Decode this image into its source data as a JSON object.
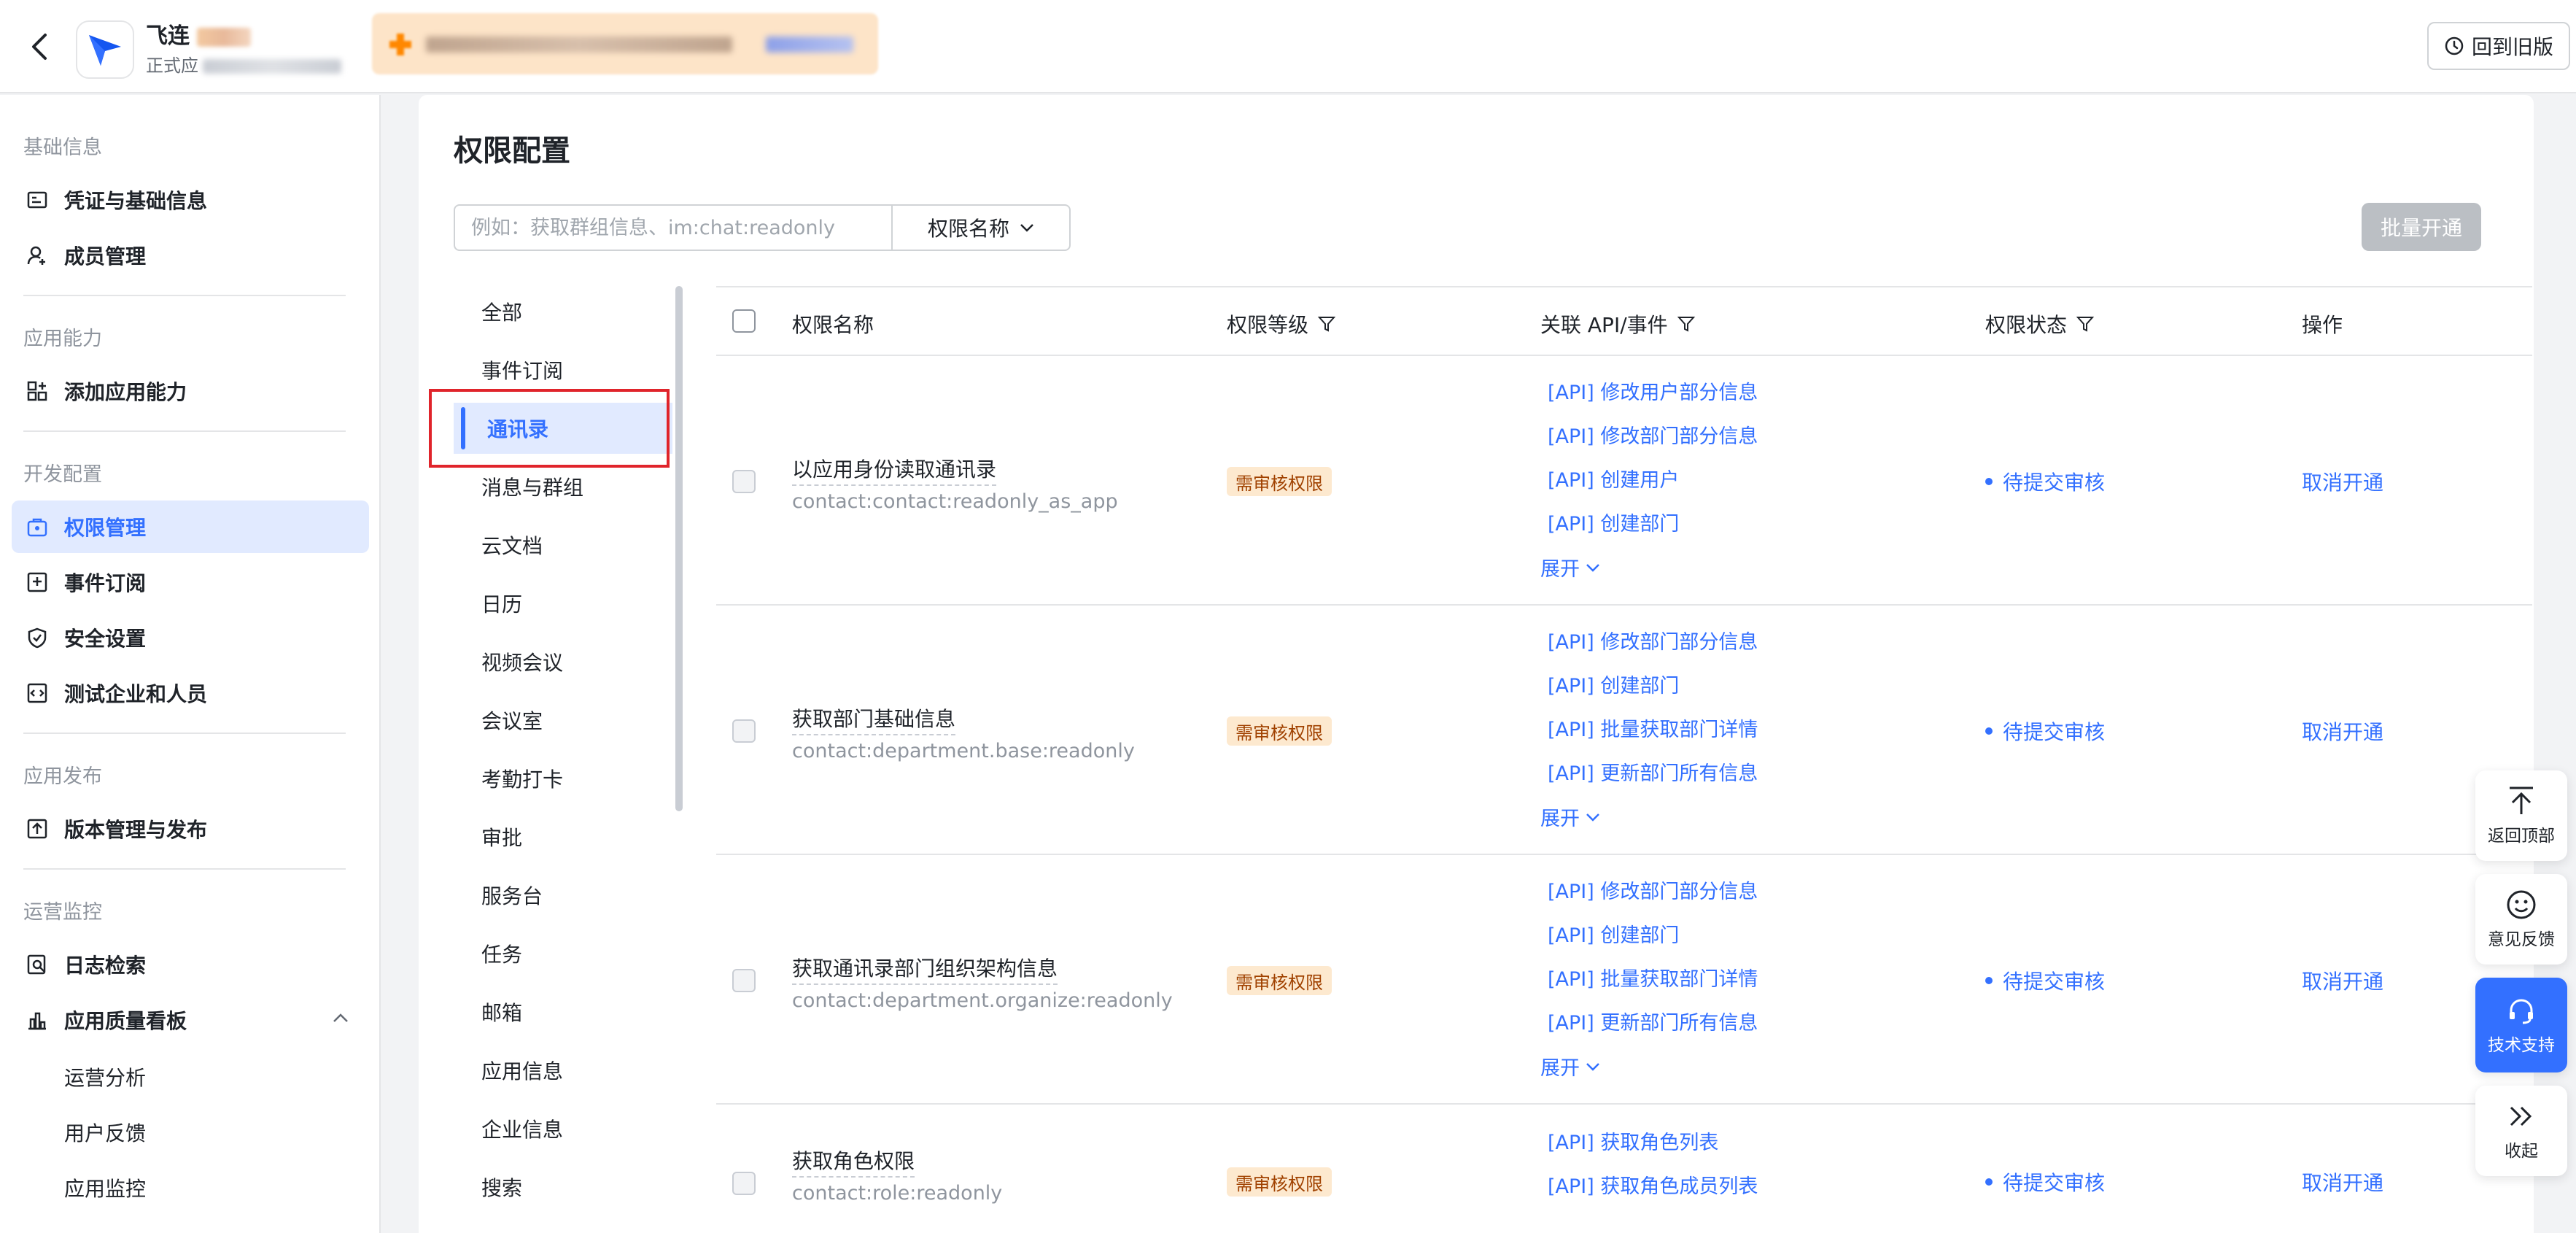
{
  "topbar": {
    "app_name": "飞连",
    "app_subtitle": "正式应",
    "old_version_label": "回到旧版"
  },
  "sidebar": {
    "groups": [
      {
        "title": "基础信息",
        "items": [
          {
            "label": "凭证与基础信息",
            "icon": "credential-icon"
          },
          {
            "label": "成员管理",
            "icon": "member-icon"
          }
        ]
      },
      {
        "title": "应用能力",
        "items": [
          {
            "label": "添加应用能力",
            "icon": "add-capability-icon"
          }
        ]
      },
      {
        "title": "开发配置",
        "items": [
          {
            "label": "权限管理",
            "icon": "permission-icon",
            "active": true
          },
          {
            "label": "事件订阅",
            "icon": "event-icon"
          },
          {
            "label": "安全设置",
            "icon": "shield-icon"
          },
          {
            "label": "测试企业和人员",
            "icon": "test-icon"
          }
        ]
      },
      {
        "title": "应用发布",
        "items": [
          {
            "label": "版本管理与发布",
            "icon": "upload-icon"
          }
        ]
      },
      {
        "title": "运营监控",
        "items": [
          {
            "label": "日志检索",
            "icon": "log-search-icon"
          },
          {
            "label": "应用质量看板",
            "icon": "chart-icon",
            "expanded": true
          }
        ]
      }
    ],
    "sub_items": [
      "运营分析",
      "用户反馈",
      "应用监控"
    ]
  },
  "main": {
    "title": "权限配置",
    "search_placeholder": "例如：获取群组信息、im:chat:readonly",
    "search_filter_label": "权限名称",
    "batch_button": "批量开通",
    "categories": [
      "全部",
      "事件订阅",
      "通讯录",
      "消息与群组",
      "云文档",
      "日历",
      "视频会议",
      "会议室",
      "考勤打卡",
      "审批",
      "服务台",
      "任务",
      "邮箱",
      "应用信息",
      "企业信息",
      "搜索"
    ],
    "active_category": "通讯录",
    "table": {
      "headers": [
        "权限名称",
        "权限等级",
        "关联 API/事件",
        "权限状态",
        "操作"
      ],
      "rows": [
        {
          "name": "以应用身份读取通讯录",
          "key": "contact:contact:readonly_as_app",
          "level": "需审核权限",
          "apis": [
            "[API] 修改用户部分信息",
            "[API] 修改部门部分信息",
            "[API] 创建用户",
            "[API] 创建部门"
          ],
          "expand": "展开",
          "status": "待提交审核",
          "action": "取消开通"
        },
        {
          "name": "获取部门基础信息",
          "key": "contact:department.base:readonly",
          "level": "需审核权限",
          "apis": [
            "[API] 修改部门部分信息",
            "[API] 创建部门",
            "[API] 批量获取部门详情",
            "[API] 更新部门所有信息"
          ],
          "expand": "展开",
          "status": "待提交审核",
          "action": "取消开通"
        },
        {
          "name": "获取通讯录部门组织架构信息",
          "key": "contact:department.organize:readonly",
          "level": "需审核权限",
          "apis": [
            "[API] 修改部门部分信息",
            "[API] 创建部门",
            "[API] 批量获取部门详情",
            "[API] 更新部门所有信息"
          ],
          "expand": "展开",
          "status": "待提交审核",
          "action": "取消开通"
        },
        {
          "name": "获取角色权限",
          "key": "contact:role:readonly",
          "level": "需审核权限",
          "apis": [
            "[API] 获取角色列表",
            "[API] 获取角色成员列表"
          ],
          "expand": "",
          "status": "待提交审核",
          "action": "取消开通"
        }
      ]
    }
  },
  "floating": [
    {
      "label": "返回顶部",
      "icon": "back-to-top-icon"
    },
    {
      "label": "意见反馈",
      "icon": "smile-icon"
    },
    {
      "label": "技术支持",
      "icon": "headset-icon"
    },
    {
      "label": "收起",
      "icon": "collapse-icon"
    }
  ]
}
